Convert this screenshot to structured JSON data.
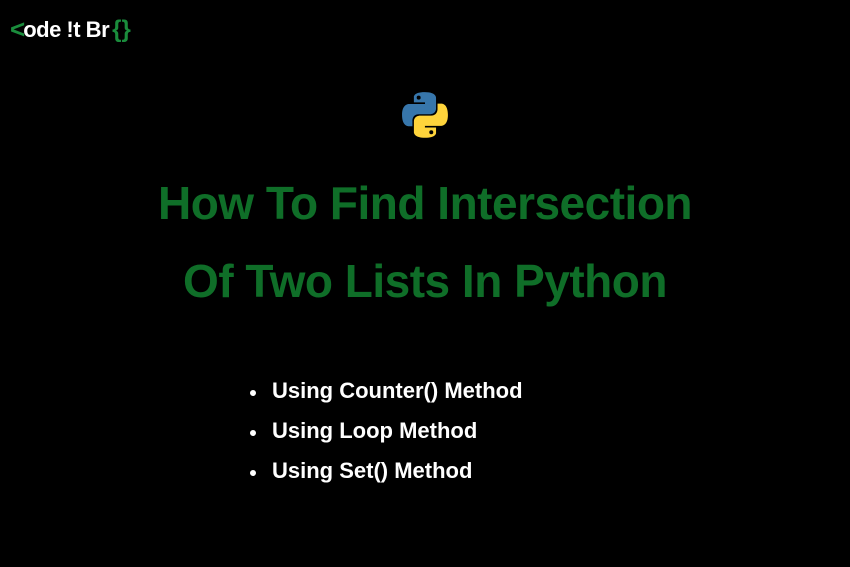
{
  "logo": {
    "text": "ode !t Br"
  },
  "title": {
    "line1": "How To Find Intersection",
    "line2": "Of Two Lists In Python"
  },
  "methods": {
    "item1": "Using Counter() Method",
    "item2": "Using Loop Method",
    "item3": "Using Set() Method"
  }
}
